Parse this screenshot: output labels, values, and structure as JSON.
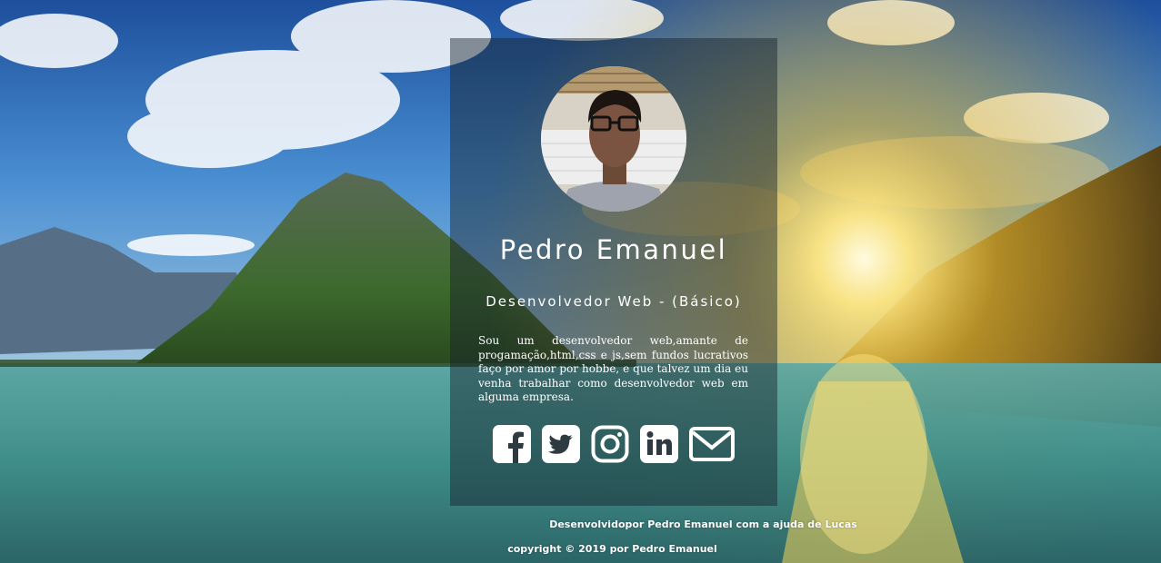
{
  "profile": {
    "name": "Pedro Emanuel",
    "role": "Desenvolvedor Web - (Básico)",
    "bio": "Sou um desenvolvedor web,amante de progamação,html,css e js,sem fundos lucrativos faço por amor por hobbe, e que talvez um dia eu venha trabalhar como desenvolvedor web em alguma empresa."
  },
  "social_icons": [
    "facebook-icon",
    "twitter-icon",
    "instagram-icon",
    "linkedin-icon",
    "email-icon"
  ],
  "footer": {
    "credit": "Desenvolvidopor Pedro Emanuel com a ajuda de Lucas",
    "copyright": "copyright © 2019 por Pedro Emanuel"
  },
  "colors": {
    "text": "#ffffff",
    "card_overlay": "rgba(20,30,40,0.45)"
  }
}
